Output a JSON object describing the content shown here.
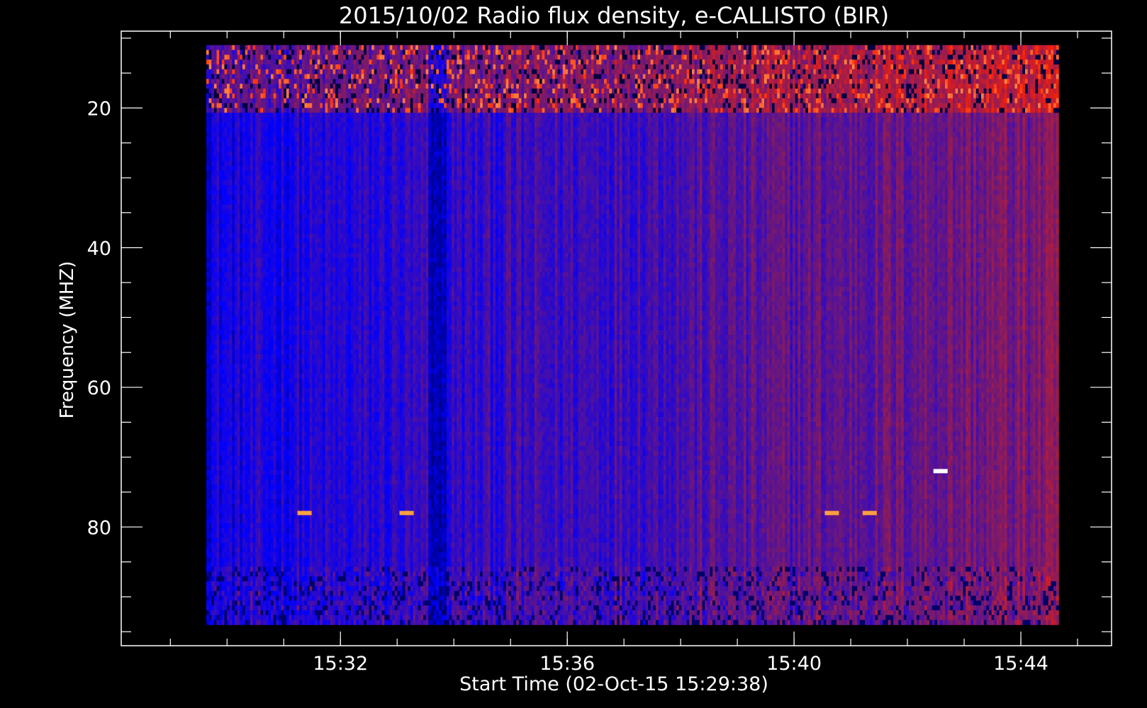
{
  "chart_data": {
    "type": "heatmap",
    "title": "2015/10/02  Radio flux density, e-CALLISTO (BIR)",
    "xlabel": "Start Time (02-Oct-15 15:29:38)",
    "ylabel": "Frequency (MHZ)",
    "x_ticks": [
      "15:32",
      "15:36",
      "15:40",
      "15:44"
    ],
    "y_ticks": [
      "20",
      "40",
      "60",
      "80"
    ],
    "x_range": [
      "15:28:08",
      "15:45:36"
    ],
    "y_range": [
      9,
      97
    ],
    "data_x_range": [
      "15:29:38",
      "15:44:40"
    ],
    "data_y_range": [
      11,
      94
    ],
    "grid": false,
    "colormap": [
      "#000000",
      "#0000ff",
      "#7a1a6a",
      "#ff2000",
      "#ffb060",
      "#ffffff"
    ],
    "features": [
      {
        "kind": "interference band",
        "freq_mhz": [
          11,
          21
        ],
        "intensity": "high"
      },
      {
        "kind": "interference band",
        "freq_mhz": [
          86,
          94
        ],
        "intensity": "medium"
      },
      {
        "kind": "spike",
        "time": "15:31:22",
        "freq_mhz": 78
      },
      {
        "kind": "spike",
        "time": "15:33:10",
        "freq_mhz": 78
      },
      {
        "kind": "spike",
        "time": "15:40:40",
        "freq_mhz": 78
      },
      {
        "kind": "spike",
        "time": "15:41:20",
        "freq_mhz": 78
      },
      {
        "kind": "spike",
        "time": "15:42:35",
        "freq_mhz": 72
      }
    ]
  }
}
